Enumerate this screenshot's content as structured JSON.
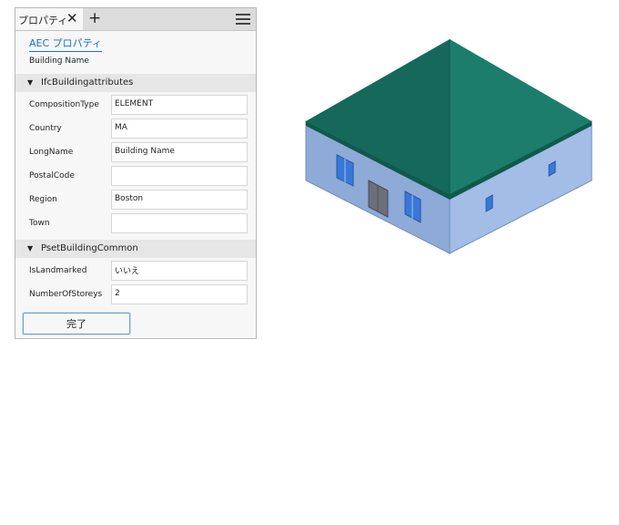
{
  "panel": {
    "tab_label": "プロパティ",
    "close_glyph": "✕",
    "add_glyph": "+",
    "menu_icon": "hamburger-menu-icon",
    "aec_link": "AEC プロパティ",
    "building_name": "Building Name",
    "sections": [
      {
        "title": "IfcBuildingattributes",
        "fields": [
          {
            "label": "CompositionType",
            "value": "ELEMENT"
          },
          {
            "label": "Country",
            "value": "MA"
          },
          {
            "label": "LongName",
            "value": "Building Name"
          },
          {
            "label": "PostalCode",
            "value": ""
          },
          {
            "label": "Region",
            "value": "Boston"
          },
          {
            "label": "Town",
            "value": ""
          }
        ]
      },
      {
        "title": "PsetBuildingCommon",
        "fields": [
          {
            "label": "IsLandmarked",
            "value": "いいえ"
          },
          {
            "label": "NumberOfStoreys",
            "value": "2"
          }
        ]
      }
    ],
    "done_label": "完了"
  },
  "colors": {
    "roof": "#16705f",
    "wall_left": "#8eaad6",
    "wall_right": "#a3bde6",
    "window": "#3a78d8",
    "door": "#6b6f7a",
    "link": "#1f6fc5"
  }
}
